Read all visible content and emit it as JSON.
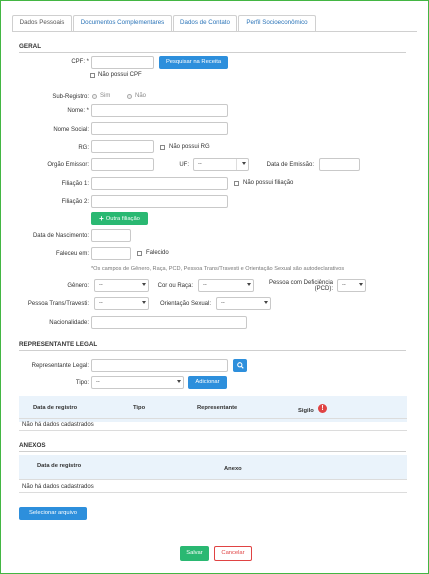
{
  "tabs": [
    "Dados Pessoais",
    "Documentos Complementares",
    "Dados de Contato",
    "Perfil Socioeconômico"
  ],
  "geral": {
    "section_title": "GERAL",
    "cpf_label": "CPF: *",
    "cpf_value": "",
    "pesquisar_button": "Pesquisar na Receita",
    "nao_possui_cpf": "Não possui CPF",
    "sub_registro_label": "Sub-Registro:",
    "sim": "Sim",
    "nao": "Não",
    "nome_label": "Nome: *",
    "nome_social_label": "Nome Social:",
    "rg_label": "RG:",
    "nao_possui_rg": "Não possui RG",
    "orgao_emissor_label": "Orgão Emissor:",
    "uf_label": "UF:",
    "uf_value": "--",
    "data_emissao_label": "Data de Emissão:",
    "filiacao1_label": "Filiação 1:",
    "nao_possui_filiacao": "Não possui filiação",
    "filiacao2_label": "Filiação 2:",
    "outra_filiacao_button": "Outra filiação",
    "data_nascimento_label": "Data de Nascimento:",
    "faleceu_label": "Faleceu em:",
    "falecido": "Falecido",
    "autodeclarativos_note": "*Os campos de Gênero, Raça, PCD, Pessoa Trans/Travesti e Orientação Sexual são autodeclarativos",
    "genero_label": "Gênero:",
    "genero_value": "--",
    "cor_raca_label": "Cor ou Raça:",
    "cor_raca_value": "--",
    "pcd_label_1": "Pessoa com Deficiência",
    "pcd_label_2": "(PCD):",
    "pcd_value": "--",
    "trans_label": "Pessoa Trans/Travesti:",
    "trans_value": "--",
    "orientacao_label": "Orientação Sexual:",
    "orientacao_value": "--",
    "nacionalidade_label": "Nacionalidade:"
  },
  "representante": {
    "section_title": "REPRESENTANTE LEGAL",
    "representante_label": "Representante Legal:",
    "tipo_label": "Tipo:",
    "tipo_value": "--",
    "adicionar_button": "Adicionar",
    "headers": [
      "Data de registro",
      "Tipo",
      "Representante",
      "Sigilo"
    ],
    "empty_text": "Não há dados cadastrados"
  },
  "anexos": {
    "section_title": "ANEXOS",
    "headers": [
      "Data de registro",
      "Anexo"
    ],
    "empty_text": "Não há dados cadastrados",
    "selecionar_button": "Selecionar arquivo"
  },
  "footer": {
    "salvar_button": "Salvar",
    "cancelar_button": "Cancelar"
  },
  "colors": {
    "primary": "#2d8fdc",
    "success": "#2ab872",
    "danger": "#e04343",
    "frame": "#43b643"
  }
}
